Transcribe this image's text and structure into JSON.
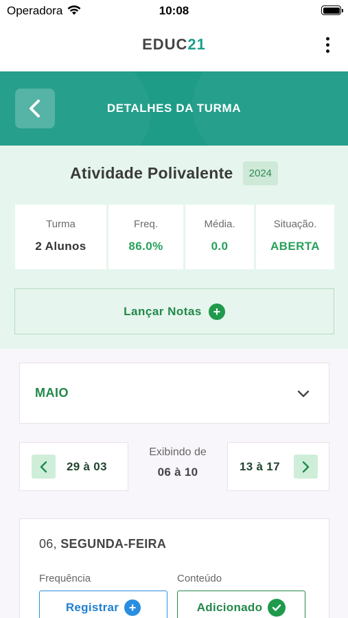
{
  "status_bar": {
    "carrier": "Operadora",
    "time": "10:08"
  },
  "header": {
    "logo_text": "EDUC",
    "logo_number": "21",
    "menu_icon": "more-vertical-icon"
  },
  "title_bar": {
    "title": "DETALHES DA TURMA",
    "back_icon": "chevron-left-icon"
  },
  "course": {
    "name": "Atividade Polivalente",
    "year": "2024"
  },
  "stats": [
    {
      "label": "Turma",
      "value": "2 Alunos"
    },
    {
      "label": "Freq.",
      "value": "86.0%"
    },
    {
      "label": "Média.",
      "value": "0.0"
    },
    {
      "label": "Situação.",
      "value": "ABERTA"
    }
  ],
  "actions": {
    "launch_grades": "Lançar Notas"
  },
  "month_selector": {
    "value": "MAIO"
  },
  "week_nav": {
    "previous": "29 à 03",
    "current_label": "Exibindo de",
    "current_range": "06 à 10",
    "next": "13 à 17"
  },
  "day": {
    "number": "06,",
    "weekday": "SEGUNDA-FEIRA",
    "frequency_label": "Frequência",
    "content_label": "Conteúdo",
    "register_button": "Registrar",
    "added_button": "Adicionado"
  },
  "colors": {
    "primary": "#1e9c88",
    "green": "#22884a",
    "blue": "#1f7fd0",
    "summary_bg": "#e6f6ee"
  }
}
